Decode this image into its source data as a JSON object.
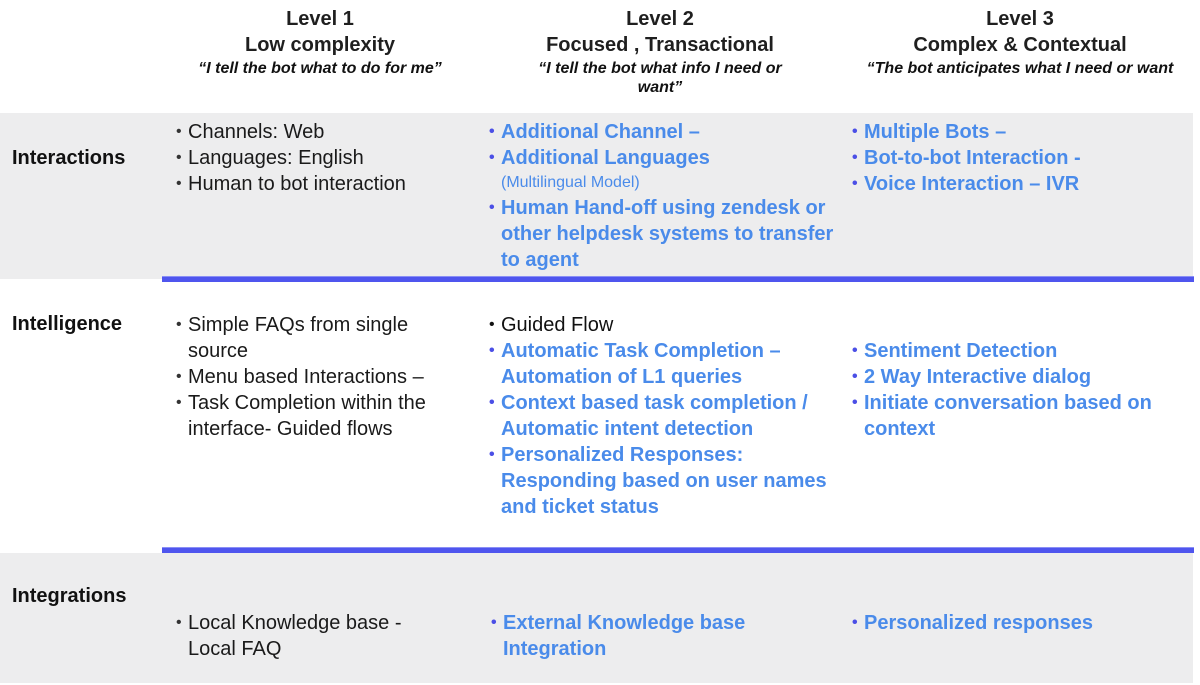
{
  "colors": {
    "accent_divider": "#4f55ee",
    "highlight_text": "#4a8bea",
    "band_background": "#ededee",
    "body_text": "#1a1a1a"
  },
  "columns": [
    {
      "level": "Level 1",
      "subtitle": "Low complexity",
      "quote": "“I tell the bot what to do for me”"
    },
    {
      "level": "Level 2",
      "subtitle": "Focused , Transactional",
      "quote": "“I tell the bot what info I need or want”"
    },
    {
      "level": "Level 3",
      "subtitle": "Complex & Contextual",
      "quote": "“The bot anticipates what I need or want"
    }
  ],
  "rows": {
    "interactions": {
      "label": "Interactions",
      "level1": [
        "Channels: Web",
        "Languages: English",
        "Human to bot interaction"
      ],
      "level2": {
        "items": [
          "Additional Channel –",
          "Additional Languages",
          "Human Hand-off using zendesk or other helpdesk systems to transfer to agent"
        ],
        "note": "(Multilingual Model)"
      },
      "level3": [
        "Multiple Bots –",
        "Bot-to-bot Interaction -",
        "Voice Interaction – IVR"
      ]
    },
    "intelligence": {
      "label": "Intelligence",
      "level1": [
        "Simple FAQs  from single source",
        "Menu based Interactions –",
        "Task Completion within the interface-  Guided flows"
      ],
      "level2": {
        "plain": "Guided Flow",
        "items": [
          "Automatic Task Completion – Automation of L1 queries",
          "Context based task completion / Automatic intent detection",
          "Personalized Responses: Responding  based on user names and ticket status"
        ]
      },
      "level3": [
        "Sentiment  Detection",
        "2 Way Interactive dialog",
        "Initiate conversation based on context"
      ]
    },
    "integrations": {
      "label": "Integrations",
      "level1": [
        "Local Knowledge base - Local FAQ"
      ],
      "level2": [
        "External Knowledge base Integration"
      ],
      "level3": [
        "Personalized responses"
      ]
    }
  },
  "bullet_glyph": "•"
}
